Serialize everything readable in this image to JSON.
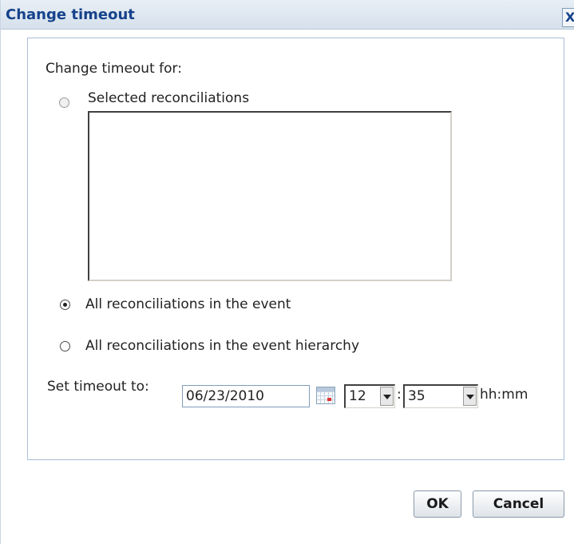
{
  "dialog": {
    "title": "Change timeout",
    "close_label": "X"
  },
  "form": {
    "change_timeout_for_label": "Change timeout for:",
    "options": [
      {
        "label": "Selected reconciliations",
        "selected": false,
        "disabled": true
      },
      {
        "label": "All reconciliations in the event",
        "selected": true,
        "disabled": false
      },
      {
        "label": "All reconciliations in the event hierarchy",
        "selected": false,
        "disabled": false
      }
    ],
    "selected_reconciliations_list": [],
    "set_timeout_label": "Set timeout to:",
    "date_value": "06/23/2010",
    "hour_value": "12",
    "separator": ":",
    "minute_value": "35",
    "time_format_label": "hh:mm"
  },
  "buttons": {
    "ok_label": "OK",
    "cancel_label": "Cancel"
  }
}
